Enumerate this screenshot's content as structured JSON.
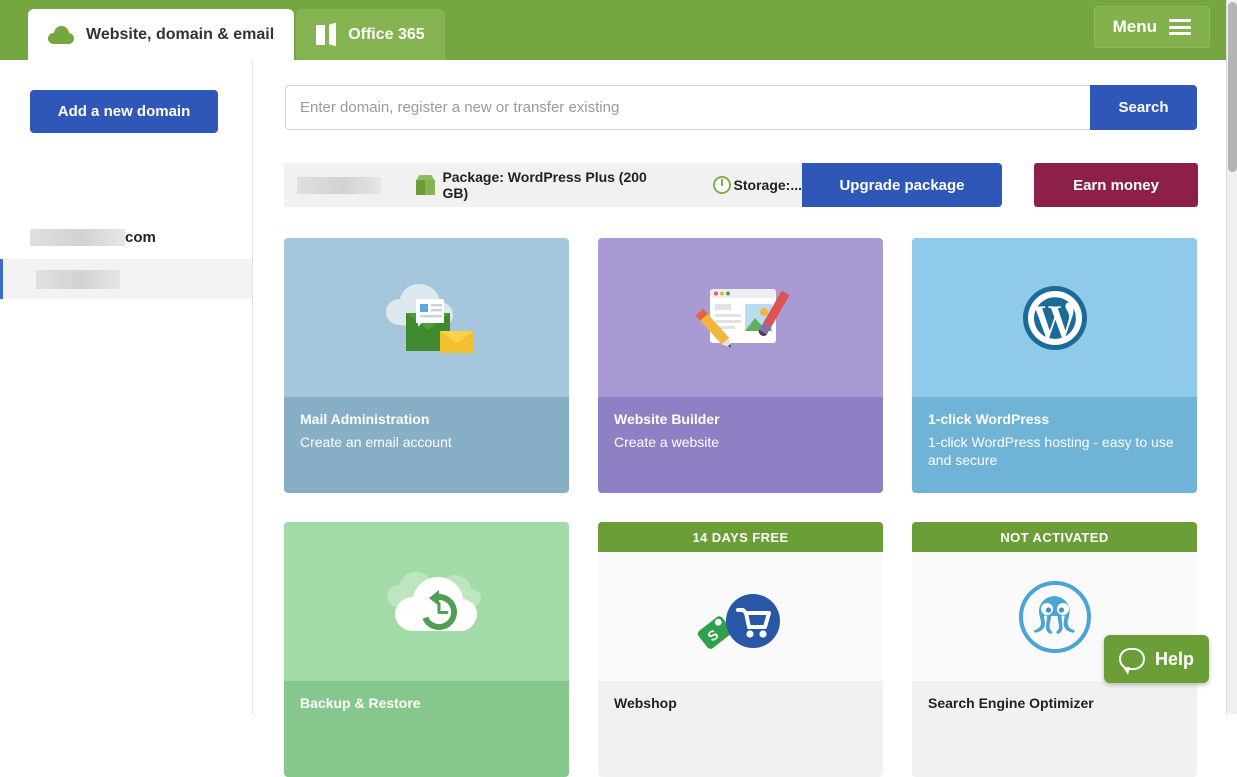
{
  "topbar": {
    "tabs": [
      {
        "label": "Website, domain & email",
        "icon": "cloud-icon",
        "active": true
      },
      {
        "label": "Office 365",
        "icon": "office365-icon",
        "active": false
      }
    ],
    "menu_label": "Menu",
    "menu_icon": "hamburger-icon",
    "bg_color": "#76a640"
  },
  "sidebar": {
    "add_domain_label": "Add a new domain",
    "add_domain_color": "#2f57b8",
    "domains": [
      {
        "name_redacted": true,
        "suffix": "com",
        "selected": false
      },
      {
        "name_redacted": true,
        "suffix": "",
        "selected": true
      }
    ]
  },
  "search": {
    "value": "",
    "placeholder": "Enter domain, register a new or transfer existing",
    "button_label": "Search",
    "button_color": "#2f57b8"
  },
  "package_bar": {
    "site_redacted": true,
    "package_icon": "package-box-icon",
    "package_label": "Package: WordPress Plus (200 GB)",
    "storage_icon": "storage-gauge-icon",
    "storage_label": "Storage:...",
    "upgrade_label": "Upgrade package",
    "earn_label": "Earn money",
    "earn_color": "#8d1f4b"
  },
  "cards": [
    {
      "key": "mail",
      "badge": "",
      "title": "Mail Administration",
      "desc": "Create an email account",
      "icon": "cloud-mail-icon",
      "accent": "#a6c6dd"
    },
    {
      "key": "builder",
      "badge": "",
      "title": "Website Builder",
      "desc": "Create a website",
      "icon": "website-builder-icon",
      "accent": "#a99ad4"
    },
    {
      "key": "wp",
      "badge": "",
      "title": "1-click WordPress",
      "desc": "1-click WordPress hosting - easy to use and secure",
      "icon": "wordpress-icon",
      "accent": "#8fcaea"
    },
    {
      "key": "backup",
      "badge": "",
      "title": "Backup & Restore",
      "desc": "",
      "icon": "cloud-restore-icon",
      "accent": "#a3dba8"
    },
    {
      "key": "shop",
      "badge": "14 DAYS FREE",
      "title": "Webshop",
      "desc": "",
      "icon": "shopping-cart-icon",
      "accent": "#6b9e36"
    },
    {
      "key": "seo",
      "badge": "NOT ACTIVATED",
      "title": "Search Engine Optimizer",
      "desc": "",
      "icon": "seo-octopus-icon",
      "accent": "#6b9e36"
    }
  ],
  "help": {
    "label": "Help",
    "icon": "speech-bubble-icon",
    "color": "#6b9e36"
  }
}
